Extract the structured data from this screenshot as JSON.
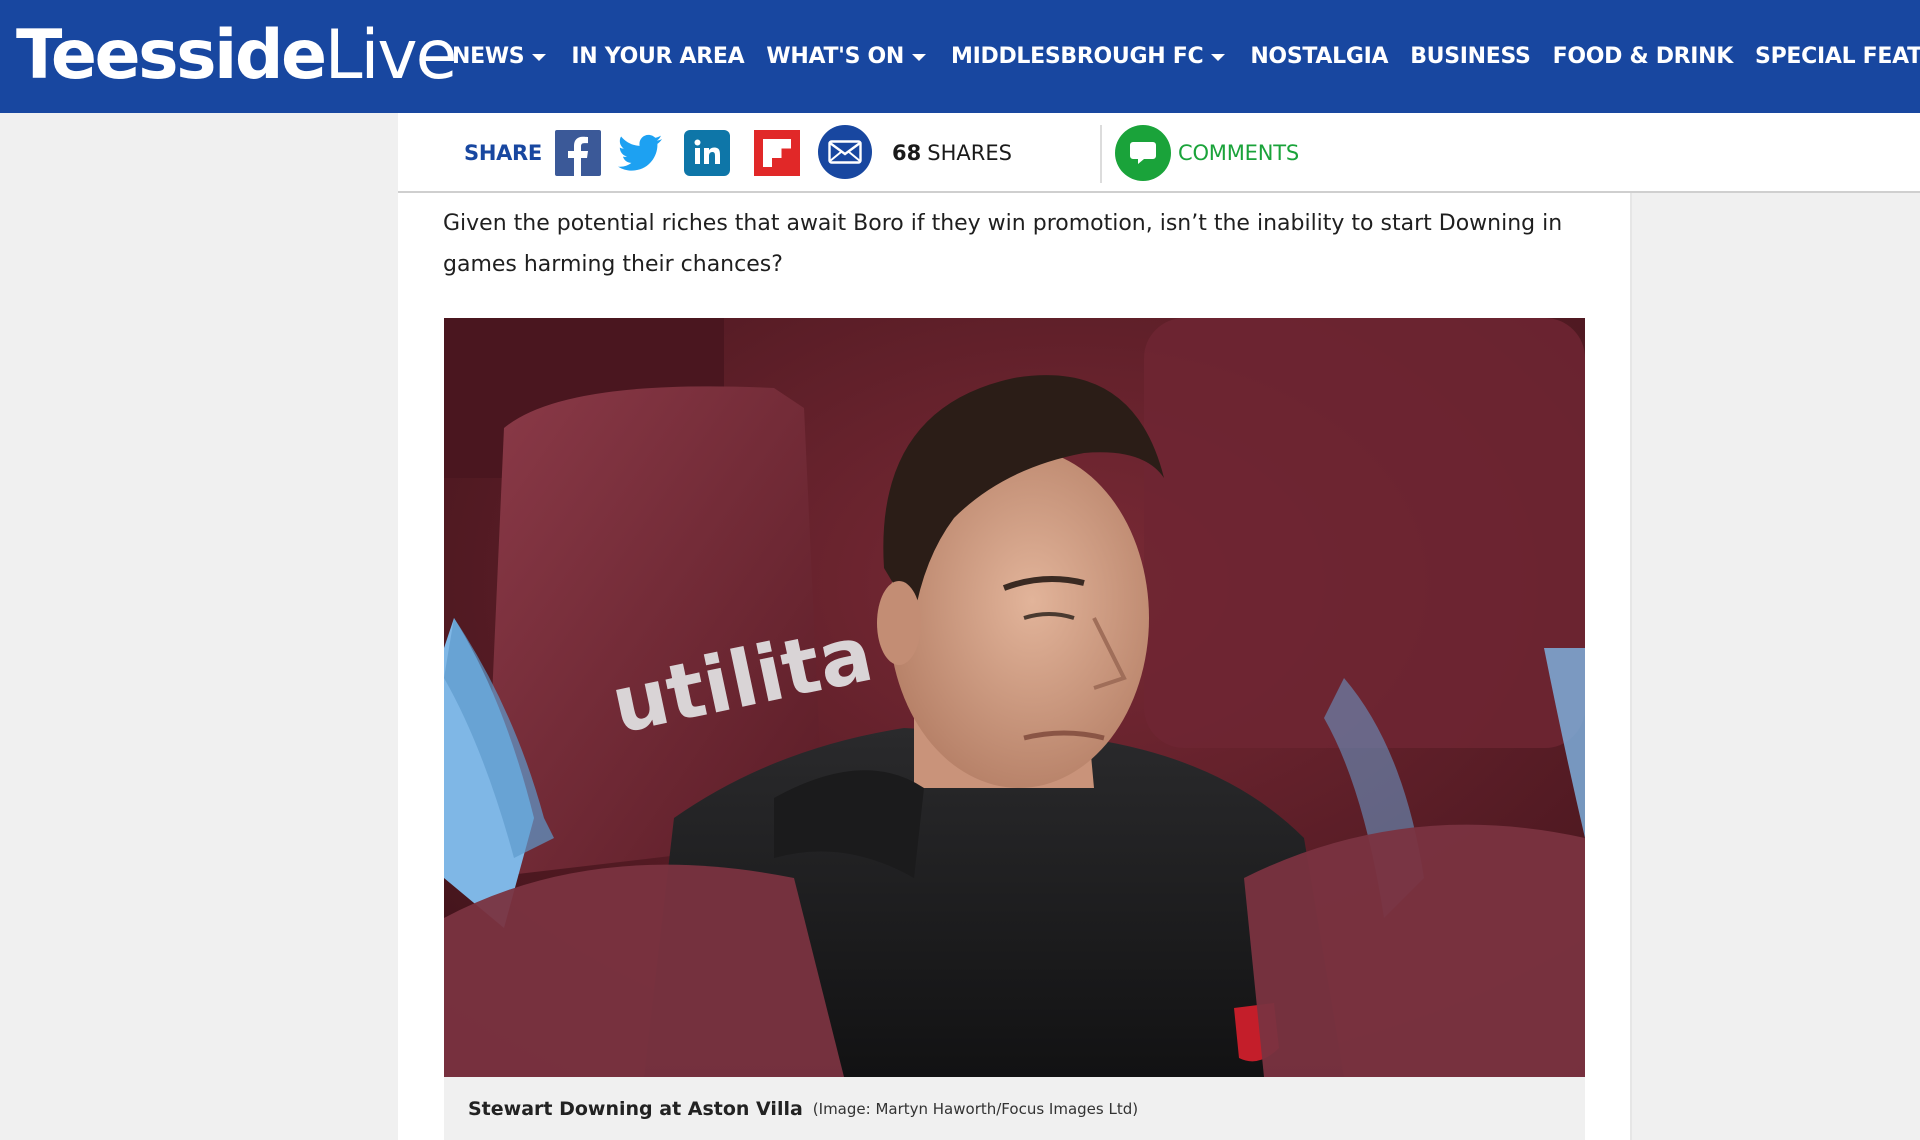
{
  "brand": {
    "logo_bold": "Teesside",
    "logo_light": "Live",
    "primary_color": "#1847a0",
    "comments_color": "#1aa33a"
  },
  "nav": {
    "items": [
      {
        "label": "NEWS",
        "dropdown": true
      },
      {
        "label": "IN YOUR AREA",
        "dropdown": false
      },
      {
        "label": "WHAT'S ON",
        "dropdown": true
      },
      {
        "label": "MIDDLESBROUGH FC",
        "dropdown": true
      },
      {
        "label": "NOSTALGIA",
        "dropdown": false
      },
      {
        "label": "BUSINESS",
        "dropdown": false
      },
      {
        "label": "FOOD & DRINK",
        "dropdown": false
      },
      {
        "label": "SPECIAL FEATURES",
        "dropdown": false
      }
    ]
  },
  "share": {
    "label": "SHARE",
    "buttons": [
      "facebook-icon",
      "twitter-icon",
      "linkedin-icon",
      "flipboard-icon",
      "email-icon"
    ],
    "count": "68",
    "count_label": "SHARES",
    "comments_label": "COMMENTS"
  },
  "article": {
    "paragraph": "Given the potential riches that await Boro if they win promotion, isn’t the inability to start Downing in games harming their chances?",
    "image": {
      "seat_branding": "utilita",
      "caption": "Stewart Downing at Aston Villa",
      "credit": "(Image: Martyn Haworth/Focus Images Ltd)"
    }
  }
}
